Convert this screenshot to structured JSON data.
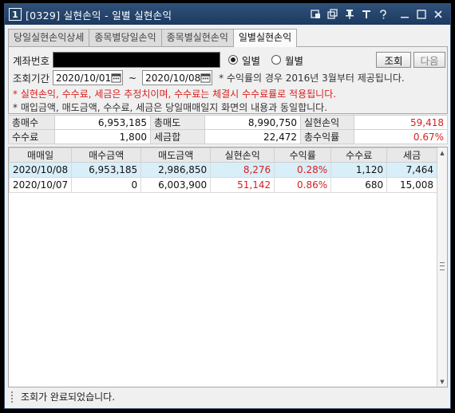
{
  "window": {
    "number": "1",
    "title": "[0329] 실현손익 - 일별 실현손익",
    "icons": [
      "link-icon",
      "copy-icon",
      "pin-icon",
      "text-size-icon",
      "help-icon",
      "minimize-icon",
      "maximize-icon",
      "close-icon"
    ]
  },
  "tabs": [
    {
      "label": "당일실현손익상세",
      "active": false
    },
    {
      "label": "종목별당일손익",
      "active": false
    },
    {
      "label": "종목별실현손익",
      "active": false
    },
    {
      "label": "일별실현손익",
      "active": true
    }
  ],
  "form": {
    "account_label": "계좌번호",
    "radio_daily": "일별",
    "radio_monthly": "월별",
    "query_button": "조회",
    "next_button": "다음",
    "period_label": "조회기간",
    "start_date": "2020/10/01",
    "tilde": "~",
    "end_date": "2020/10/08",
    "period_note": "* 수익률의 경우 2016년 3월부터 제공됩니다.",
    "note_red": "* 실현손익, 수수료, 세금은 추정치이며, 수수료는 체결시 수수료률로 적용됩니다.",
    "note_gray": "* 매입금액, 매도금액, 수수료, 세금은 당일매매일지 화면의 내용과 동일합니다."
  },
  "summary": {
    "total_buy_label": "총매수",
    "total_buy": "6,953,185",
    "total_sell_label": "총매도",
    "total_sell": "8,990,750",
    "realized_label": "실현손익",
    "realized": "59,418",
    "fee_label": "수수료",
    "fee": "1,800",
    "tax_label": "세금합",
    "tax": "22,472",
    "return_label": "총수익률",
    "return": "0.67%"
  },
  "grid": {
    "headers": [
      "매매일",
      "매수금액",
      "매도금액",
      "실현손익",
      "수익률",
      "수수료",
      "세금"
    ],
    "rows": [
      [
        "2020/10/08",
        "6,953,185",
        "2,986,850",
        "8,276",
        "0.28%",
        "1,120",
        "7,464"
      ],
      [
        "2020/10/07",
        "0",
        "6,003,900",
        "51,142",
        "0.86%",
        "680",
        "15,008"
      ]
    ]
  },
  "status": {
    "message": "조회가 완료되었습니다."
  },
  "colors": {
    "title_bar": "#234469",
    "positive": "#d81e1e",
    "selected_row": "#d8eef8"
  }
}
